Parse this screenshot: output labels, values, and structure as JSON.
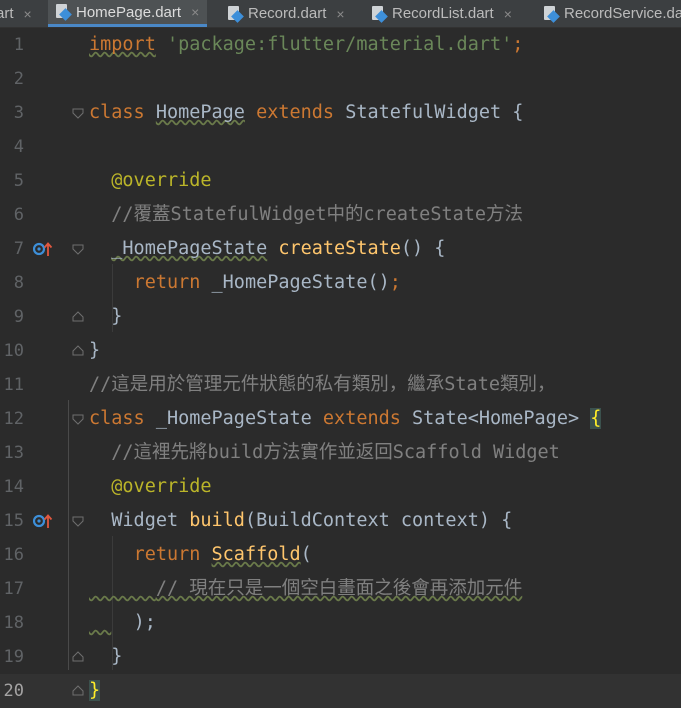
{
  "tabs": [
    {
      "label": "art",
      "active": false
    },
    {
      "label": "HomePage.dart",
      "active": true
    },
    {
      "label": "Record.dart",
      "active": false
    },
    {
      "label": "RecordList.dart",
      "active": false
    },
    {
      "label": "RecordService.da",
      "active": false
    }
  ],
  "tab_close_glyph": "×",
  "editor": {
    "current_line": 20,
    "lines": [
      {
        "num": "1"
      },
      {
        "num": "2"
      },
      {
        "num": "3"
      },
      {
        "num": "4"
      },
      {
        "num": "5"
      },
      {
        "num": "6"
      },
      {
        "num": "7"
      },
      {
        "num": "8"
      },
      {
        "num": "9"
      },
      {
        "num": "10"
      },
      {
        "num": "11"
      },
      {
        "num": "12"
      },
      {
        "num": "13"
      },
      {
        "num": "14"
      },
      {
        "num": "15"
      },
      {
        "num": "16"
      },
      {
        "num": "17"
      },
      {
        "num": "18"
      },
      {
        "num": "19"
      },
      {
        "num": "20"
      }
    ],
    "code": {
      "l1_kw": "import",
      "l1_str": "'package:flutter/material.dart'",
      "l1_end": ";",
      "l3_kw": "class",
      "l3_name": "HomePage",
      "l3_ext": "extends",
      "l3_base": "StatefulWidget {",
      "l5_ann": "@override",
      "l6_comment": "//覆蓋StatefulWidget中的createState方法",
      "l7_type": "_HomePageState",
      "l7_fn": "createState",
      "l7_rest": "() {",
      "l8_kw": "return",
      "l8_rest": "_HomePageState()",
      "l8_end": ";",
      "l9": "}",
      "l10": "}",
      "l11_comment": "//這是用於管理元件狀態的私有類別，繼承State類別，",
      "l12_kw": "class",
      "l12_name": "_HomePageState",
      "l12_ext": "extends",
      "l12_base": "State<HomePage>",
      "l12_brace": "{",
      "l13_comment": "//這裡先將build方法實作並返回Scaffold Widget",
      "l14_ann": "@override",
      "l15_type": "Widget",
      "l15_fn": "build",
      "l15_rest": "(BuildContext context) {",
      "l16_kw": "return",
      "l16_fn": "Scaffold",
      "l16_rest": "(",
      "l17_comment": "// 現在只是一個空白畫面之後會再添加元件",
      "l18": ");",
      "l19": "}",
      "l20": "}"
    }
  },
  "colors": {
    "background": "#2b2b2b",
    "keyword": "#cc7832",
    "string": "#6a8759",
    "comment": "#808080",
    "annotation": "#bbb529",
    "function": "#ffc66d",
    "text": "#a9b7c6",
    "override_marker": "#3d8fd9",
    "override_arrow": "#e0573f"
  },
  "icons": {
    "override_gutter": "override-implements-icon",
    "fold": "fold-toggle-icon",
    "tab_file": "dart-file-icon"
  }
}
